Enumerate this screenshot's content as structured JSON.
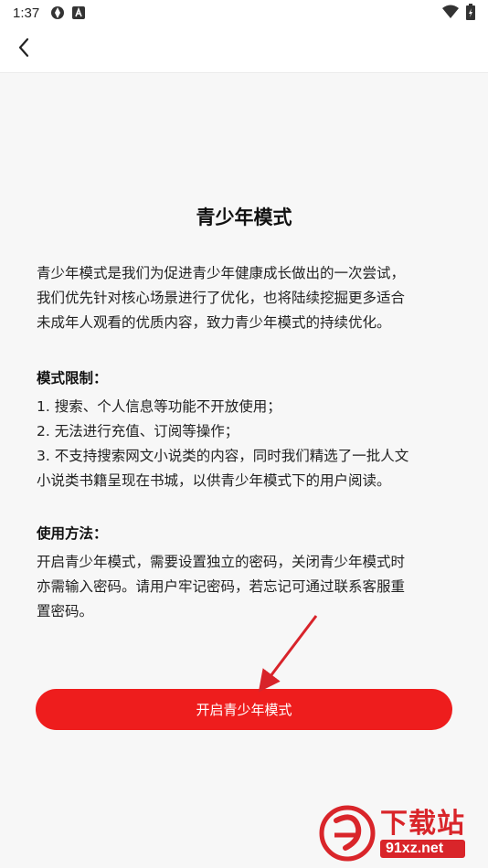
{
  "status_bar": {
    "time": "1:37",
    "icons": [
      "vpn-icon",
      "android-notification-icon",
      "wifi-icon",
      "battery-icon"
    ]
  },
  "header": {
    "back_icon": "back-arrow-icon"
  },
  "main": {
    "title": "青少年模式",
    "intro_lines": [
      "青少年模式是我们为促进青少年健康成长做出的一次尝试，",
      "我们优先针对核心场景进行了优化，也将陆续挖掘更多适合",
      "未成年人观看的优质内容，致力青少年模式的持续优化。"
    ],
    "restrictions_heading": "模式限制：",
    "restrictions": [
      "1. 搜索、个人信息等功能不开放使用；",
      "2. 无法进行充值、订阅等操作；",
      "3. 不支持搜索网文小说类的内容，同时我们精选了一批人文",
      "小说类书籍呈现在书城，以供青少年模式下的用户阅读。"
    ],
    "usage_heading": "使用方法：",
    "usage_lines": [
      "开启青少年模式，需要设置独立的密码，关闭青少年模式时",
      "亦需输入密码。请用户牢记密码，若忘记可通过联系客服重",
      "置密码。"
    ],
    "enable_button_label": "开启青少年模式"
  },
  "colors": {
    "accent": "#ee1d1d",
    "background": "#f7f7f7",
    "annotation_arrow": "#d8232a"
  },
  "watermark": {
    "cn_text": "下载站",
    "url_text": "91xz.net"
  }
}
